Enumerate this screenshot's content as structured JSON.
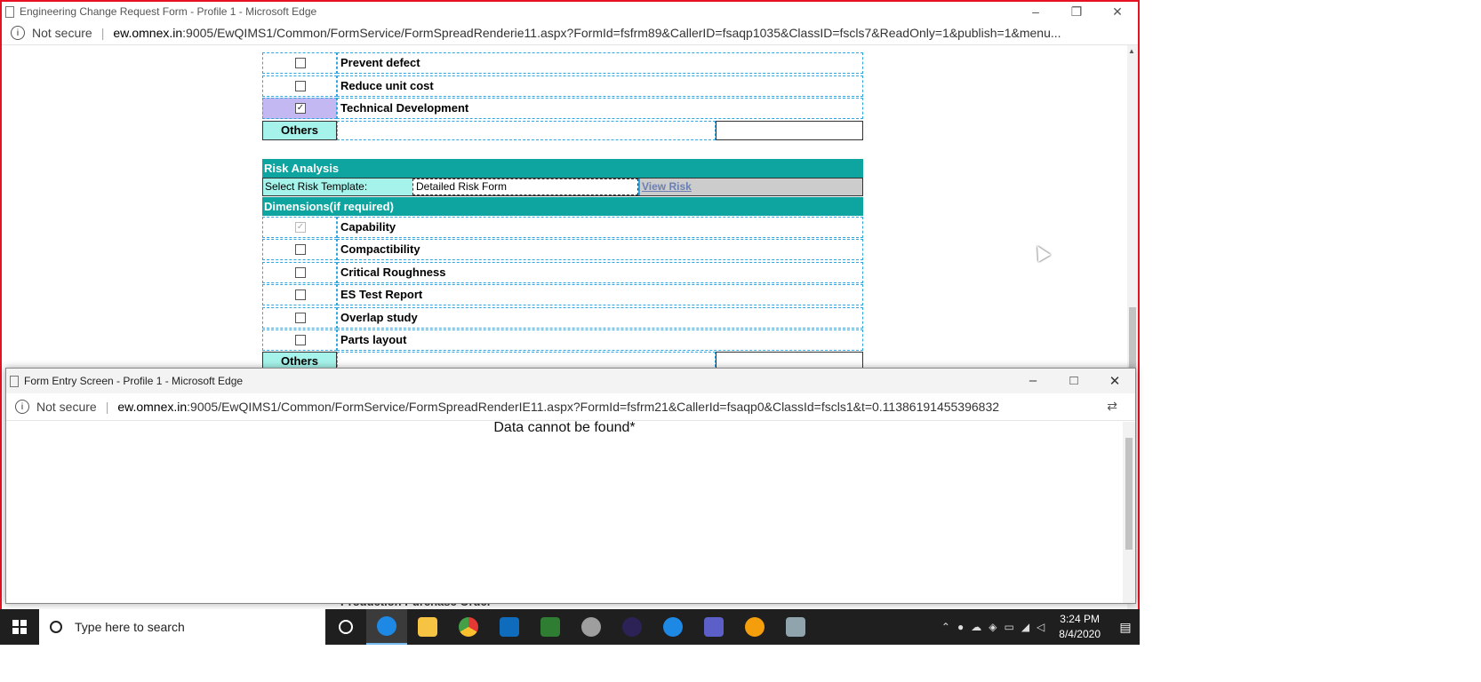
{
  "window1": {
    "title": "Engineering Change Request Form - Profile 1 - Microsoft Edge",
    "not_secure": "Not secure",
    "url_host": "ew.omnex.in",
    "url_rest": ":9005/EwQIMS1/Common/FormService/FormSpreadRenderie11.aspx?FormId=fsfrm89&CallerID=fsaqp1035&ClassID=fscls7&ReadOnly=1&publish=1&menu..."
  },
  "form": {
    "reason_items": [
      {
        "label": "Prevent defect",
        "checked": false
      },
      {
        "label": "Reduce unit cost",
        "checked": false
      },
      {
        "label": "Technical Development",
        "checked": true
      }
    ],
    "others_label": "Others",
    "risk_header": "Risk Analysis",
    "risk_template_label": "Select Risk Template:",
    "risk_template_value": "Detailed Risk Form",
    "view_risk": "View Risk",
    "dimensions_header": "Dimensions(if required)",
    "dimension_items": [
      {
        "label": "Capability",
        "checked": true,
        "disabled": true
      },
      {
        "label": "Compactibility",
        "checked": false
      },
      {
        "label": "Critical Roughness",
        "checked": false
      },
      {
        "label": "ES Test Report",
        "checked": false
      },
      {
        "label": "Overlap study",
        "checked": false
      },
      {
        "label": "Parts layout",
        "checked": false
      }
    ],
    "others_label2": "Others",
    "peek_label": "Production Purchase Order"
  },
  "window2": {
    "title": "Form Entry Screen - Profile 1 - Microsoft Edge",
    "not_secure": "Not secure",
    "url_host": "ew.omnex.in",
    "url_rest": ":9005/EwQIMS1/Common/FormService/FormSpreadRenderIE11.aspx?FormId=fsfrm21&CallerId=fsaqp0&ClassId=fscls1&t=0.11386191455396832",
    "message": "Data cannot be found*"
  },
  "taskbar": {
    "search_placeholder": "Type here to search",
    "time": "3:24 PM",
    "date": "8/4/2020",
    "apps": [
      {
        "name": "cortana-icon",
        "color": "#1f1f1f"
      },
      {
        "name": "edge-icon",
        "color": "#1e88e5"
      },
      {
        "name": "file-explorer-icon",
        "color": "#f6c342"
      },
      {
        "name": "chrome-icon",
        "color": "#e53935"
      },
      {
        "name": "outlook-icon",
        "color": "#0f6cbd"
      },
      {
        "name": "spreadsheet-icon",
        "color": "#2e7d32"
      },
      {
        "name": "paint-icon",
        "color": "#9e9e9e"
      },
      {
        "name": "eclipse-icon",
        "color": "#2c2255"
      },
      {
        "name": "ie-icon",
        "color": "#1e88e5"
      },
      {
        "name": "teams-icon",
        "color": "#5b5fc7"
      },
      {
        "name": "orange-app-icon",
        "color": "#f59e0b"
      },
      {
        "name": "remote-desktop-icon",
        "color": "#90a4ae"
      }
    ]
  }
}
